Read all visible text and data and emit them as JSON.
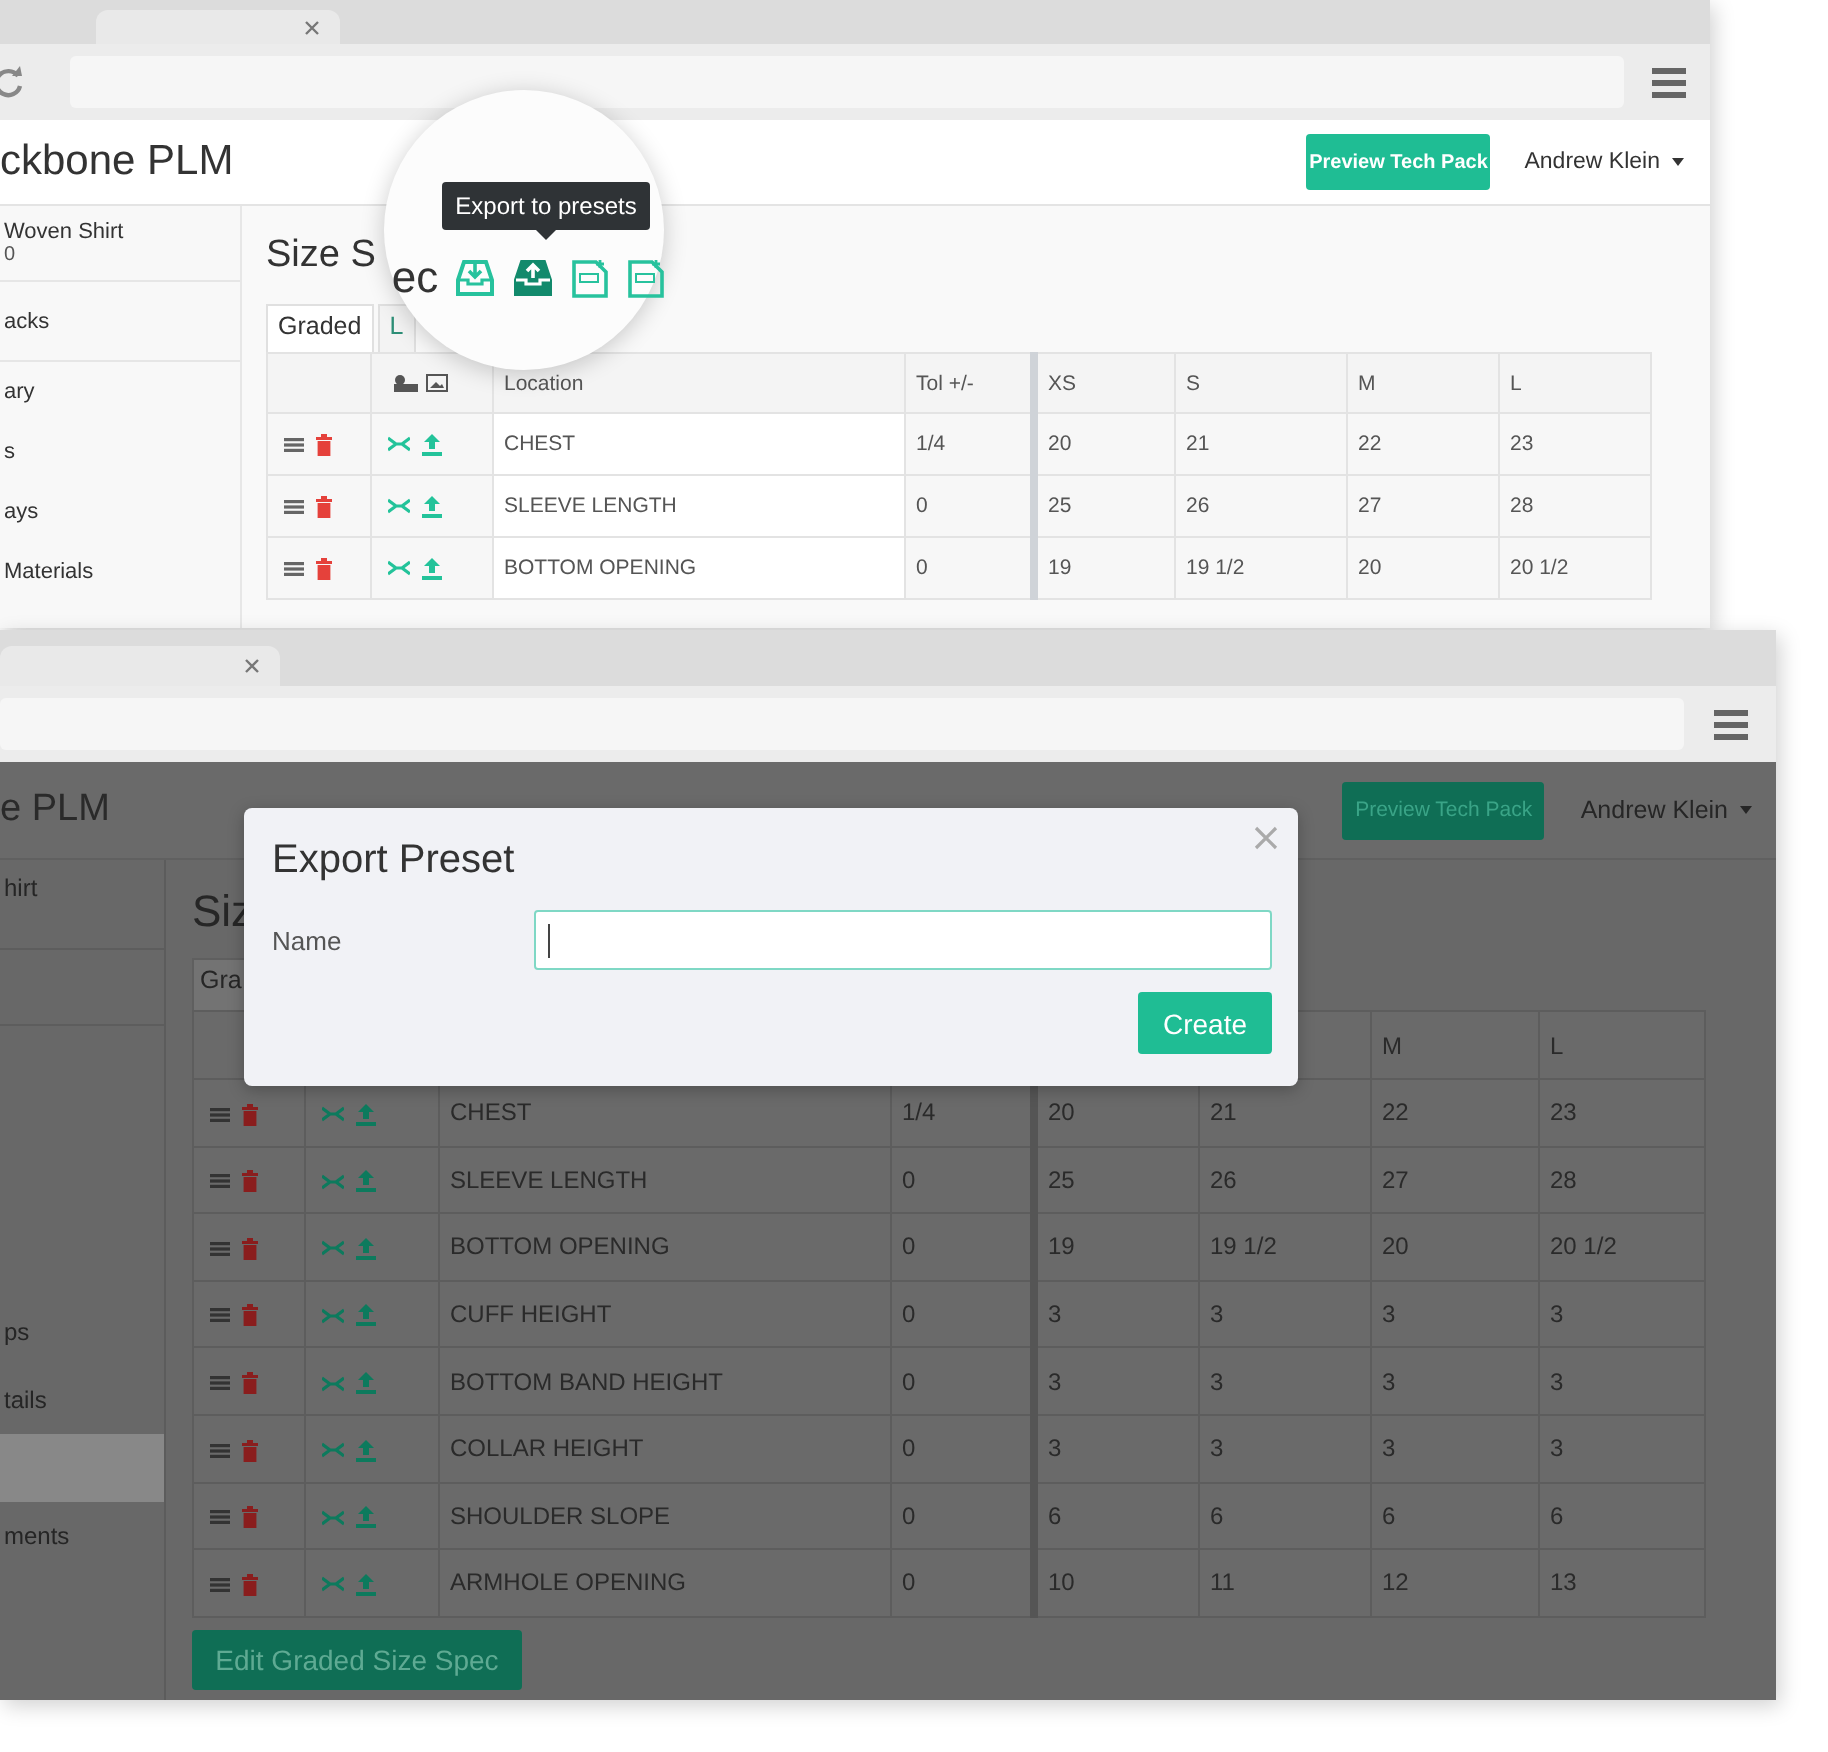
{
  "windows": [
    {
      "kind": "background",
      "app_title": "ckbone PLM",
      "preview_button": "Preview Tech Pack",
      "user_menu": "Andrew Klein",
      "sidebar": {
        "items": [
          {
            "kind": "group",
            "label": "Woven Shirt",
            "sublabel": "0",
            "selected": false
          },
          {
            "kind": "group",
            "label": "acks",
            "selected": false
          },
          {
            "kind": "link",
            "label": "ary",
            "selected": false
          },
          {
            "kind": "link",
            "label": "s",
            "selected": false
          },
          {
            "kind": "link",
            "label": "ays",
            "selected": false
          },
          {
            "kind": "link",
            "label": "Materials",
            "selected": false
          }
        ]
      },
      "page_title": "Size S",
      "tabs": [
        {
          "label": "Graded",
          "selected": true
        },
        {
          "label": "L",
          "selected": false
        }
      ],
      "table": {
        "columns": [
          "Location",
          "Tol +/-",
          "XS",
          "S",
          "M",
          "L"
        ],
        "rows": [
          {
            "cells": [
              "CHEST",
              "1/4",
              "20",
              "21",
              "22",
              "23"
            ]
          },
          {
            "cells": [
              "SLEEVE LENGTH",
              "0",
              "25",
              "26",
              "27",
              "28"
            ]
          },
          {
            "cells": [
              "BOTTOM OPENING",
              "0",
              "19",
              "19 1/2",
              "20",
              "20 1/2"
            ]
          }
        ]
      }
    },
    {
      "kind": "foreground",
      "app_title": "e PLM",
      "preview_button": "Preview Tech Pack",
      "user_menu": "Andrew Klein",
      "sidebar": {
        "items": [
          {
            "kind": "group",
            "label": "hirt",
            "selected": false
          },
          {
            "kind": "group",
            "selected": false
          },
          {
            "kind": "link",
            "selected": false
          },
          {
            "kind": "link",
            "selected": false
          },
          {
            "kind": "link",
            "selected": false
          },
          {
            "kind": "link",
            "selected": false
          },
          {
            "kind": "link",
            "label": "ps",
            "selected": false
          },
          {
            "kind": "link",
            "label": "tails",
            "selected": false
          },
          {
            "kind": "link",
            "selected": true
          },
          {
            "kind": "link",
            "label": "ments",
            "selected": false
          }
        ]
      },
      "page_title": "Siz",
      "tabs": [
        {
          "label": "Gra",
          "selected": true
        }
      ],
      "table": {
        "columns": [
          "",
          "",
          "",
          "",
          "M",
          "L"
        ],
        "rows": [
          {
            "cells": [
              "CHEST",
              "1/4",
              "20",
              "21",
              "22",
              "23"
            ]
          },
          {
            "cells": [
              "SLEEVE LENGTH",
              "0",
              "25",
              "26",
              "27",
              "28"
            ]
          },
          {
            "cells": [
              "BOTTOM OPENING",
              "0",
              "19",
              "19 1/2",
              "20",
              "20 1/2"
            ]
          },
          {
            "cells": [
              "CUFF HEIGHT",
              "0",
              "3",
              "3",
              "3",
              "3"
            ]
          },
          {
            "cells": [
              "BOTTOM BAND HEIGHT",
              "0",
              "3",
              "3",
              "3",
              "3"
            ]
          },
          {
            "cells": [
              "COLLAR HEIGHT",
              "0",
              "3",
              "3",
              "3",
              "3"
            ]
          },
          {
            "cells": [
              "SHOULDER SLOPE",
              "0",
              "6",
              "6",
              "6",
              "6"
            ]
          },
          {
            "cells": [
              "ARMHOLE OPENING",
              "0",
              "10",
              "11",
              "12",
              "13"
            ]
          }
        ]
      },
      "edit_button": "Edit Graded Size Spec"
    }
  ],
  "magnifier": {
    "title_fragment": "ec",
    "tooltip": "Export to presets",
    "icons": [
      {
        "kind": "import",
        "selected": false
      },
      {
        "kind": "export",
        "selected": true
      },
      {
        "kind": "csv-import",
        "selected": false
      },
      {
        "kind": "csv-export",
        "selected": false
      }
    ]
  },
  "dialog": {
    "title": "Export Preset",
    "field_label": "Name",
    "name_field": {
      "focused": true
    },
    "button": "Create"
  }
}
